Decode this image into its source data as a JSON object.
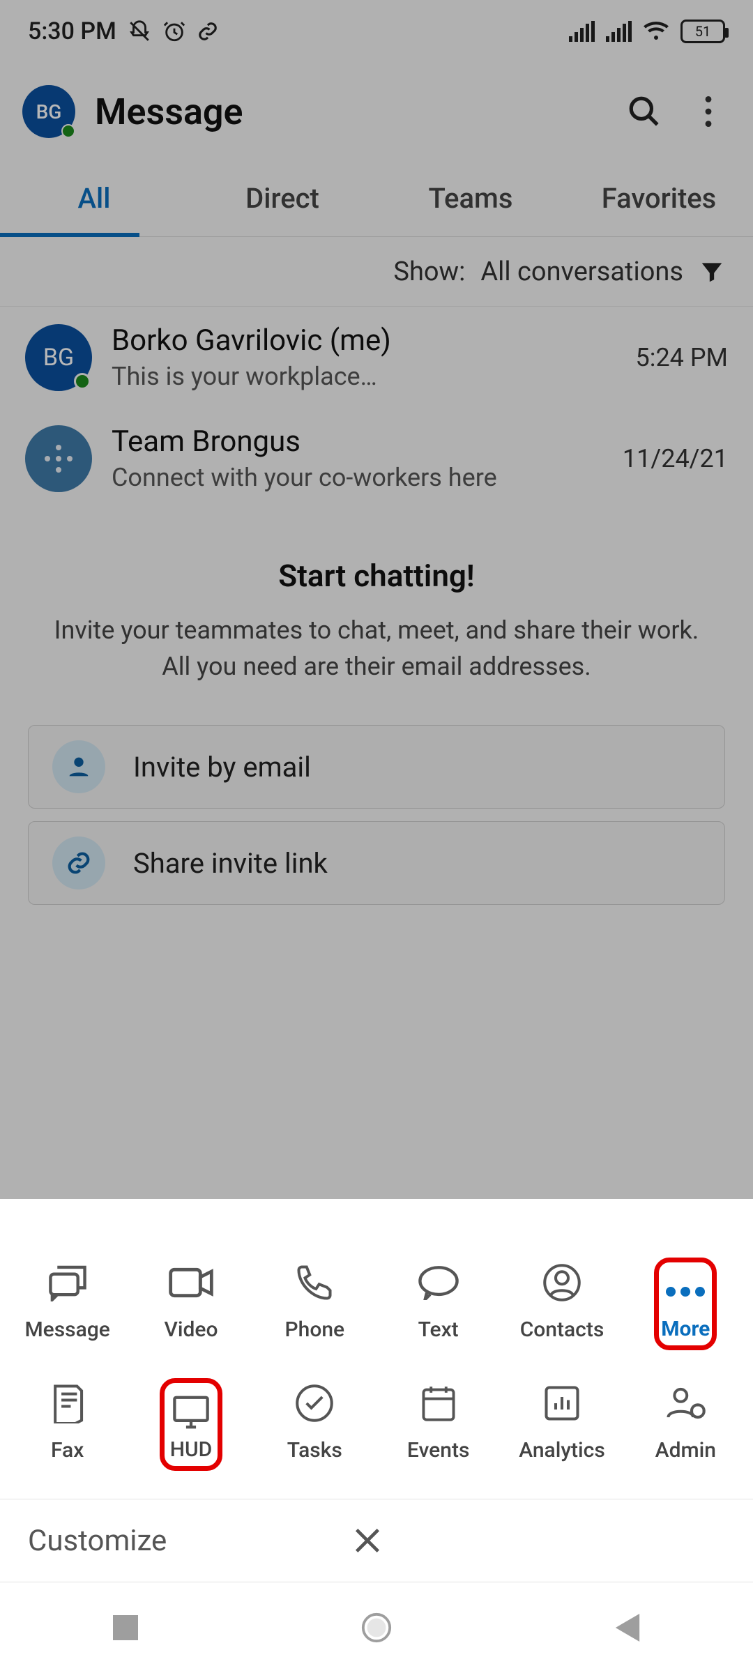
{
  "status": {
    "time": "5:30 PM",
    "battery": "51"
  },
  "header": {
    "avatar_initials": "BG",
    "title": "Message"
  },
  "tabs": [
    {
      "label": "All",
      "active": true
    },
    {
      "label": "Direct",
      "active": false
    },
    {
      "label": "Teams",
      "active": false
    },
    {
      "label": "Favorites",
      "active": false
    }
  ],
  "filter": {
    "show_label": "Show:",
    "value": "All conversations"
  },
  "conversations": [
    {
      "avatar_type": "initials",
      "initials": "BG",
      "name": "Borko Gavrilovic (me)",
      "snippet": "This is your workplace…",
      "time": "5:24 PM",
      "presence": true
    },
    {
      "avatar_type": "team",
      "name": "Team Brongus",
      "snippet": "Connect with your co-workers here",
      "time": "11/24/21"
    }
  ],
  "empty": {
    "title": "Start chatting!",
    "desc": "Invite your teammates to chat, meet, and share their work. All you need are their email addresses."
  },
  "invites": {
    "by_email": "Invite by email",
    "share_link": "Share invite link"
  },
  "nav_row1": [
    {
      "icon": "message",
      "label": "Message"
    },
    {
      "icon": "video",
      "label": "Video"
    },
    {
      "icon": "phone",
      "label": "Phone"
    },
    {
      "icon": "text",
      "label": "Text"
    },
    {
      "icon": "contacts",
      "label": "Contacts"
    },
    {
      "icon": "more",
      "label": "More",
      "active": true,
      "highlight": true
    }
  ],
  "nav_row2": [
    {
      "icon": "fax",
      "label": "Fax"
    },
    {
      "icon": "hud",
      "label": "HUD",
      "highlight": true
    },
    {
      "icon": "tasks",
      "label": "Tasks"
    },
    {
      "icon": "events",
      "label": "Events"
    },
    {
      "icon": "analytics",
      "label": "Analytics"
    },
    {
      "icon": "admin",
      "label": "Admin"
    }
  ],
  "customize": {
    "label": "Customize"
  }
}
